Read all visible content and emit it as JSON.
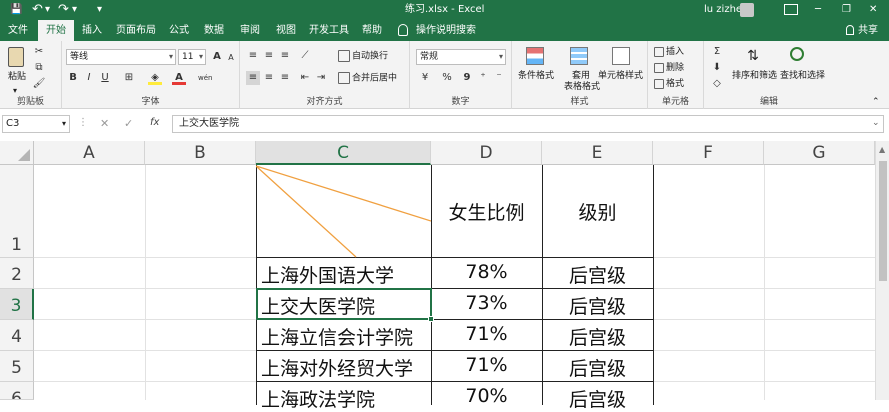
{
  "titlebar": {
    "title": "练习.xlsx - Excel",
    "user": "lu zizhe",
    "minimize": "─",
    "restore": "❐",
    "close": "✕",
    "save_glyph": "💾",
    "undo_glyph": "↶",
    "redo_glyph": "↷",
    "qat_more": "▾"
  },
  "tabs": [
    "文件",
    "开始",
    "插入",
    "页面布局",
    "公式",
    "数据",
    "审阅",
    "视图",
    "开发工具",
    "帮助"
  ],
  "tell_me": "操作说明搜索",
  "share": "共享",
  "ribbon": {
    "clipboard": {
      "paste": "粘贴",
      "label": "剪贴板"
    },
    "font": {
      "name": "等线",
      "size": "11",
      "bold": "B",
      "italic": "I",
      "underline": "U",
      "grow": "A",
      "shrink": "A",
      "label": "字体",
      "phonetic": "wén"
    },
    "alignment": {
      "wrap": "自动换行",
      "merge": "合并后居中",
      "label": "对齐方式"
    },
    "number": {
      "format": "常规",
      "percent": "%",
      "comma": "9",
      "label": "数字"
    },
    "styles": {
      "conditional": "条件格式",
      "table1": "套用",
      "table2": "表格格式",
      "cell_styles": "单元格样式",
      "label": "样式"
    },
    "cells": {
      "insert": "插入",
      "delete": "删除",
      "format": "格式",
      "label": "单元格"
    },
    "editing": {
      "sort": "排序和筛选",
      "find": "查找和选择",
      "label": "编辑",
      "sigma": "Σ"
    }
  },
  "formula_bar": {
    "name_box": "C3",
    "formula": "上交大医学院",
    "fx": "fx",
    "cancel": "✕",
    "confirm": "✓"
  },
  "sheet": {
    "columns": [
      "A",
      "B",
      "C",
      "D",
      "E",
      "F",
      "G"
    ],
    "rows": [
      "1",
      "2",
      "3",
      "4",
      "5",
      "6"
    ],
    "selected_cell": "C3",
    "header_d": "女生比例",
    "header_e": "级别",
    "data": [
      {
        "school": "上海外国语大学",
        "ratio": "78%",
        "level": "后宫级"
      },
      {
        "school": "上交大医学院",
        "ratio": "73%",
        "level": "后宫级"
      },
      {
        "school": "上海立信会计学院",
        "ratio": "71%",
        "level": "后宫级"
      },
      {
        "school": "上海对外经贸大学",
        "ratio": "71%",
        "level": "后宫级"
      },
      {
        "school": "上海政法学院",
        "ratio": "70%",
        "level": "后宫级"
      }
    ]
  },
  "colors": {
    "accent": "#217346",
    "diagonal": "#f0a040"
  }
}
